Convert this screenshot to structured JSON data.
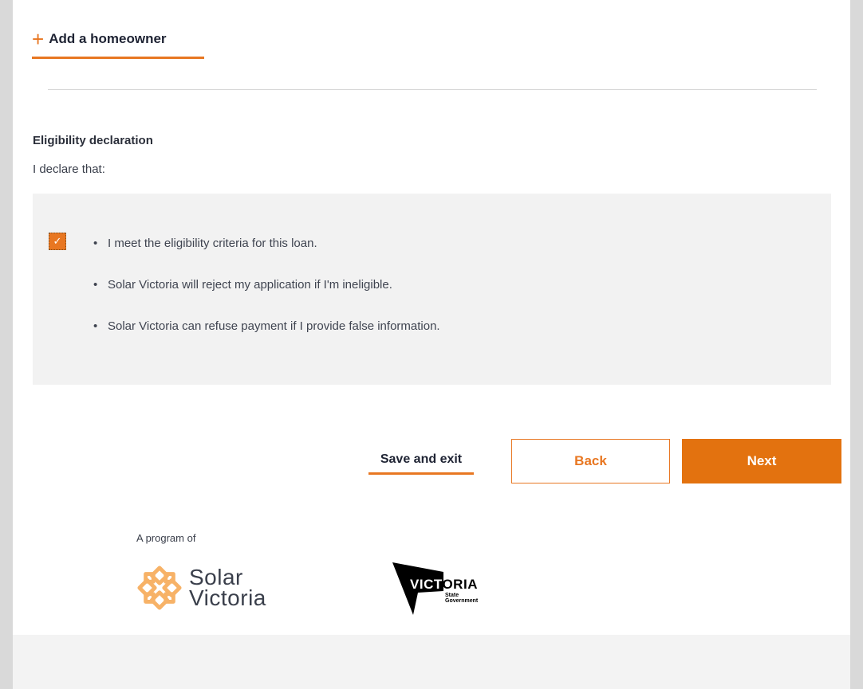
{
  "homeowner": {
    "add_label": "Add a homeowner"
  },
  "declaration": {
    "title": "Eligibility declaration",
    "intro": "I declare that:",
    "checked": true,
    "items": [
      "I meet the eligibility criteria for this loan.",
      "Solar Victoria will reject my application if I'm ineligible.",
      "Solar Victoria can refuse payment if I provide false information."
    ]
  },
  "actions": {
    "save_exit": "Save and exit",
    "back": "Back",
    "next": "Next"
  },
  "footer": {
    "program_of": "A program of",
    "solar_victoria_line1": "Solar",
    "solar_victoria_line2": "Victoria",
    "victoria_word": "VICTORIA",
    "victoria_sub1": "State",
    "victoria_sub2": "Government"
  },
  "colors": {
    "accent": "#e87722",
    "next_button": "#e3720f",
    "panel": "#f2f2f2"
  }
}
